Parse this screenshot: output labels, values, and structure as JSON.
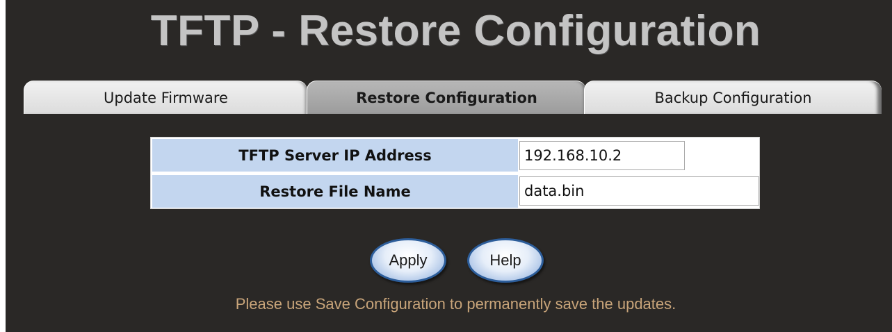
{
  "page": {
    "title": "TFTP - Restore Configuration"
  },
  "tabs": [
    {
      "label": "Update Firmware",
      "active": false
    },
    {
      "label": "Restore Configuration",
      "active": true
    },
    {
      "label": "Backup Configuration",
      "active": false
    }
  ],
  "form": {
    "server_ip": {
      "label": "TFTP Server IP Address",
      "value": "192.168.10.2"
    },
    "file_name": {
      "label": "Restore File Name",
      "value": "data.bin"
    }
  },
  "buttons": {
    "apply_label": "Apply",
    "help_label": "Help"
  },
  "note": "Please use Save Configuration to permanently save the updates.",
  "colors": {
    "background": "#2a2826",
    "title": "#c4c4c4",
    "label_cell": "#c3d6ef",
    "note_text": "#c9a57a",
    "button_border": "#2c5d9a"
  }
}
